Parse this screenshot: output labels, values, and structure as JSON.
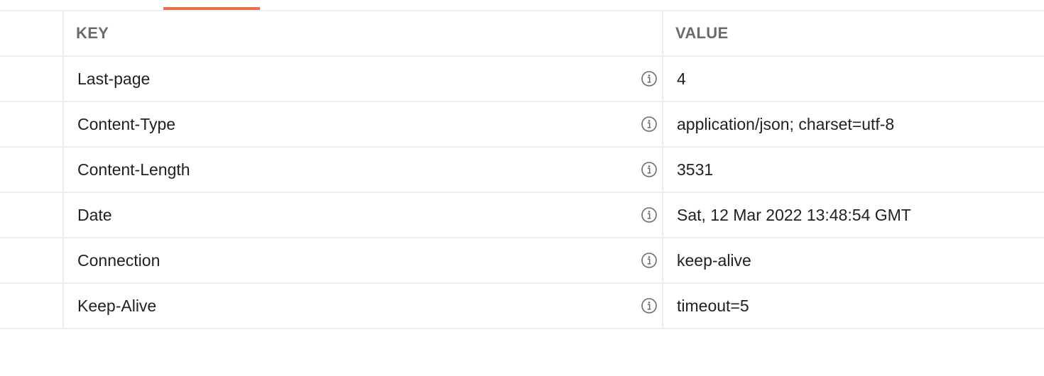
{
  "colors": {
    "accent": "#e8704d",
    "border": "#ededed",
    "header_text": "#6b6b6b",
    "body_text": "#212121",
    "icon": "#6b6b6b"
  },
  "table": {
    "columns": {
      "key": "KEY",
      "value": "VALUE"
    },
    "rows": [
      {
        "key": "Last-page",
        "value": "4",
        "icon": "info-icon"
      },
      {
        "key": "Content-Type",
        "value": "application/json; charset=utf-8",
        "icon": "info-icon"
      },
      {
        "key": "Content-Length",
        "value": "3531",
        "icon": "info-icon"
      },
      {
        "key": "Date",
        "value": "Sat, 12 Mar 2022 13:48:54 GMT",
        "icon": "info-icon"
      },
      {
        "key": "Connection",
        "value": "keep-alive",
        "icon": "info-icon"
      },
      {
        "key": "Keep-Alive",
        "value": "timeout=5",
        "icon": "info-icon"
      }
    ]
  }
}
